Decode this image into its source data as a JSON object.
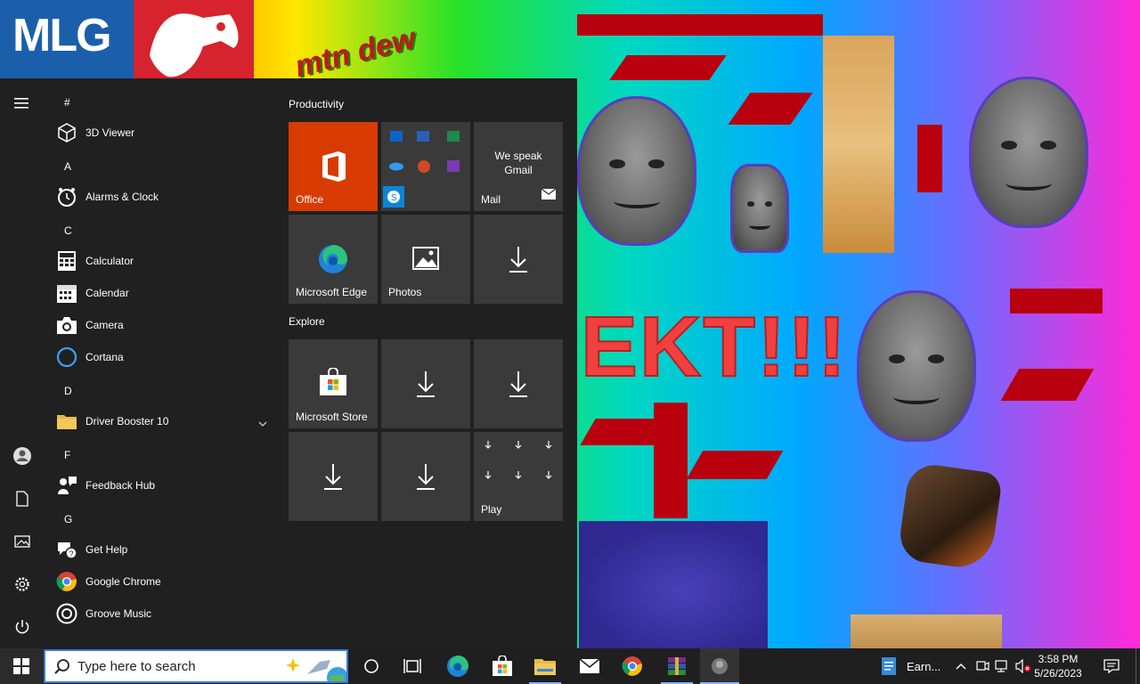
{
  "wallpaper": {
    "logo_text": "MLG",
    "drink_text": "mtn dew",
    "meme_text": "EKT!!!"
  },
  "start_menu": {
    "sections": [
      {
        "letter": "#",
        "apps": [
          {
            "label": "3D Viewer",
            "icon": "cube-icon"
          }
        ]
      },
      {
        "letter": "A",
        "apps": [
          {
            "label": "Alarms & Clock",
            "icon": "clock-icon"
          }
        ]
      },
      {
        "letter": "C",
        "apps": [
          {
            "label": "Calculator",
            "icon": "calculator-icon"
          },
          {
            "label": "Calendar",
            "icon": "calendar-icon"
          },
          {
            "label": "Camera",
            "icon": "camera-icon"
          },
          {
            "label": "Cortana",
            "icon": "cortana-icon"
          }
        ]
      },
      {
        "letter": "D",
        "apps": [
          {
            "label": "Driver Booster 10",
            "icon": "folder-icon",
            "expandable": true
          }
        ]
      },
      {
        "letter": "F",
        "apps": [
          {
            "label": "Feedback Hub",
            "icon": "feedback-icon"
          }
        ]
      },
      {
        "letter": "G",
        "apps": [
          {
            "label": "Get Help",
            "icon": "help-icon"
          },
          {
            "label": "Google Chrome",
            "icon": "chrome-icon"
          },
          {
            "label": "Groove Music",
            "icon": "groove-icon"
          }
        ]
      }
    ],
    "groups": {
      "productivity": "Productivity",
      "explore": "Explore"
    },
    "tiles": {
      "office": "Office",
      "mail_top": "We speak Gmail",
      "mail": "Mail",
      "edge": "Microsoft Edge",
      "photos": "Photos",
      "store": "Microsoft Store",
      "play": "Play"
    },
    "colors": {
      "office": "#d83b01",
      "tile": "#3a3a3a",
      "panel": "#202020"
    }
  },
  "taskbar": {
    "search_placeholder": "Type here to search",
    "pinned": [
      "cortana-icon",
      "task-view-icon",
      "edge-icon",
      "store-icon",
      "file-explorer-icon",
      "mail-icon",
      "chrome-icon",
      "winrar-icon",
      "photo-icon"
    ],
    "notes_label": "Earn...",
    "time": "3:58 PM",
    "date": "5/26/2023"
  }
}
